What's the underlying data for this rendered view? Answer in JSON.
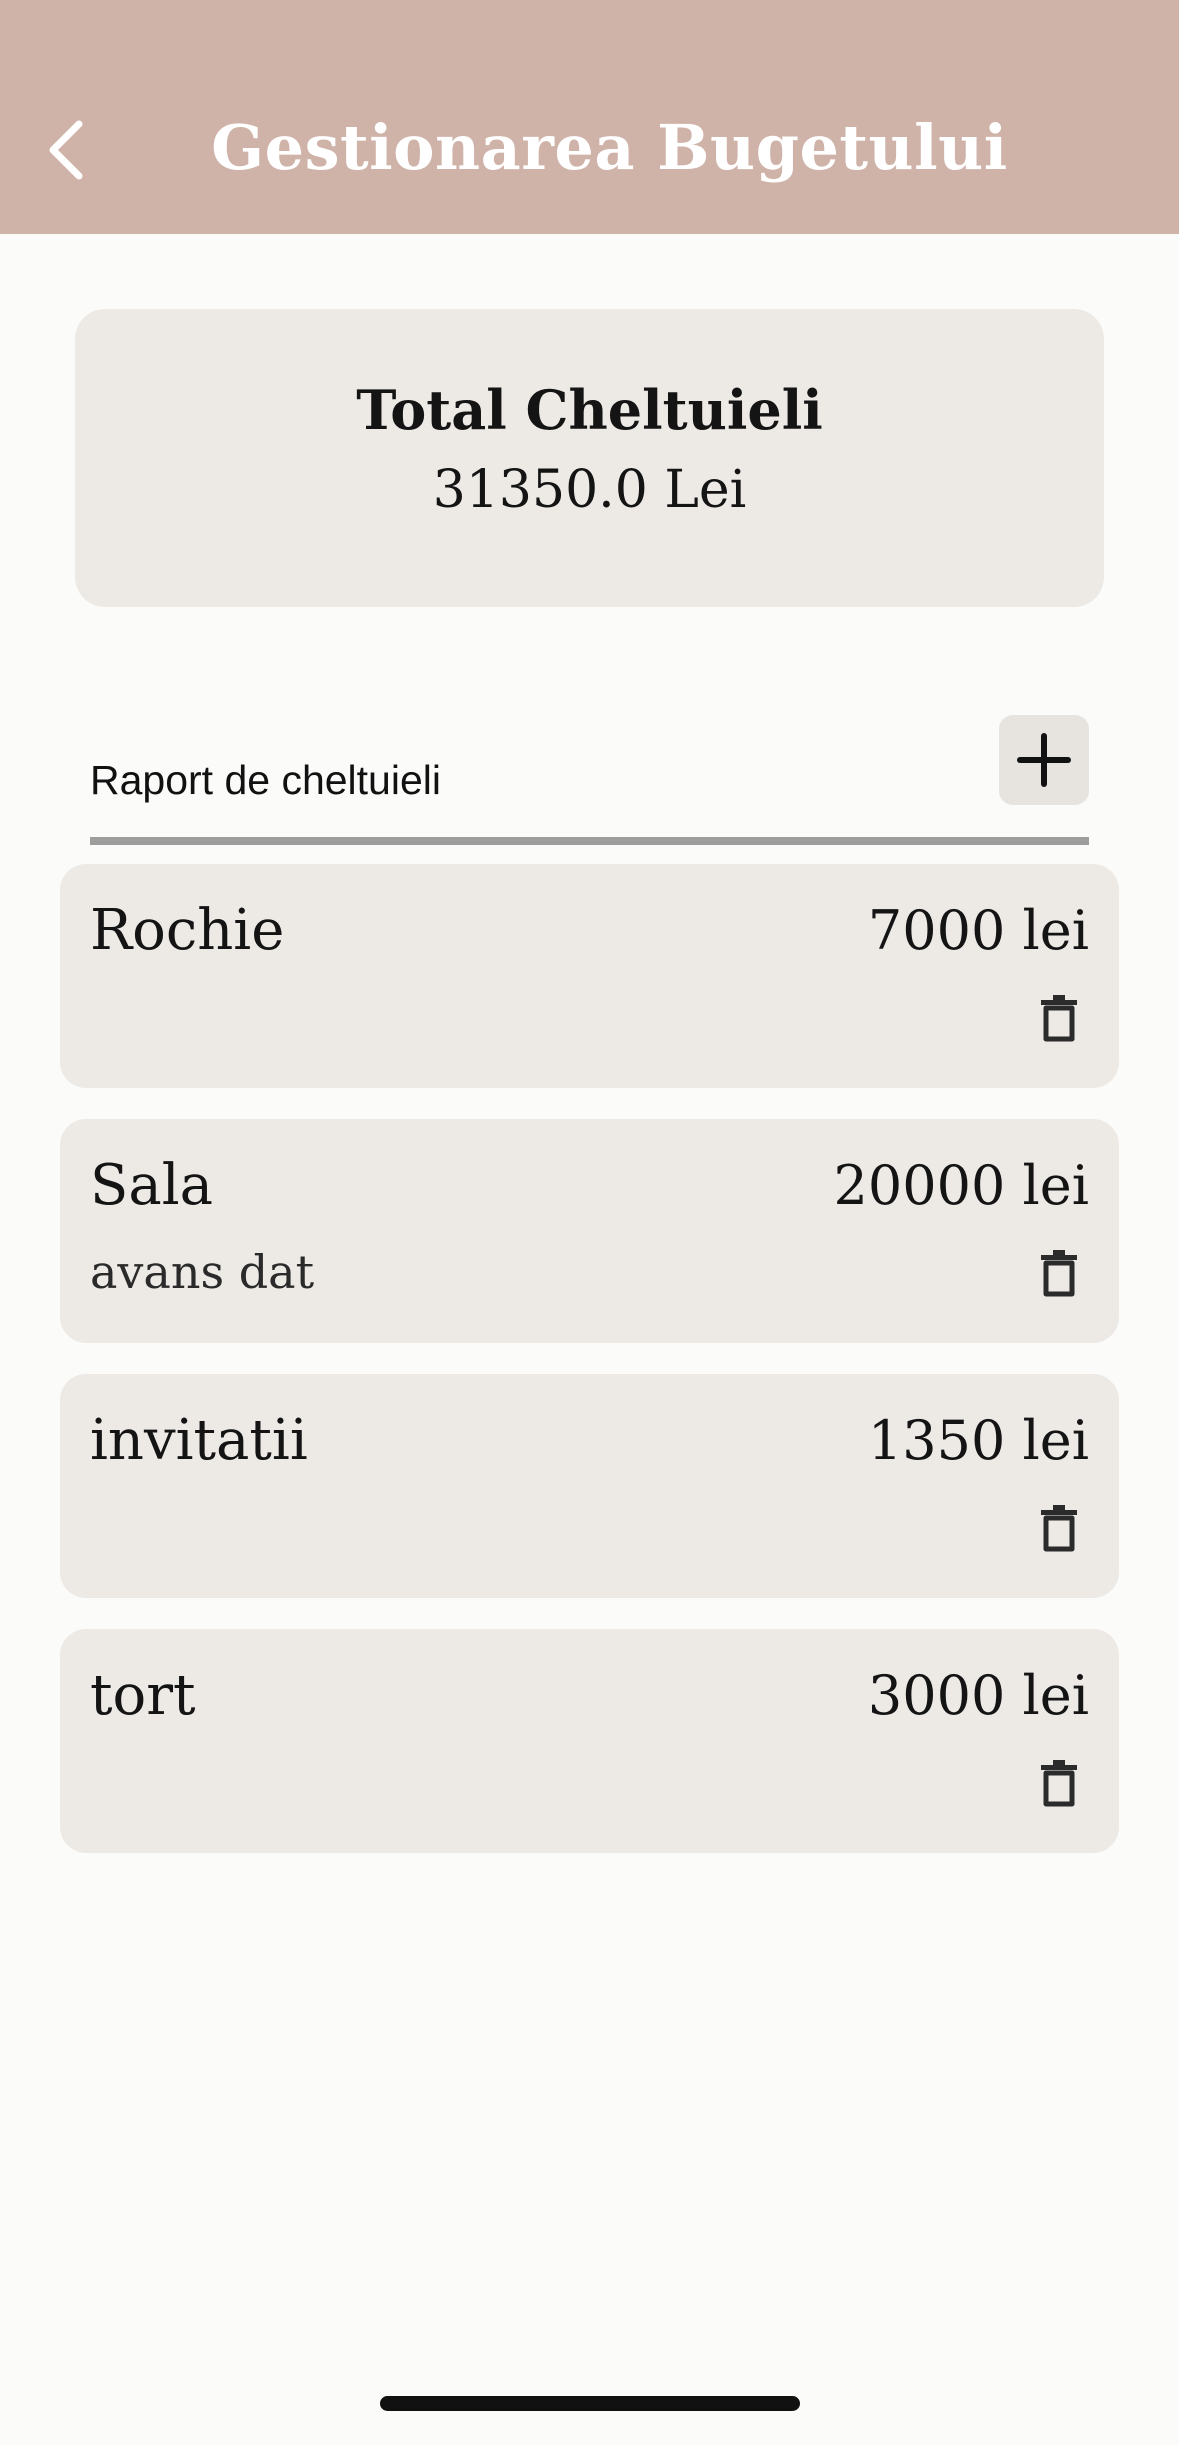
{
  "appbar": {
    "title": "Gestionarea Bugetului",
    "back_icon": "chevron-left-icon",
    "background": "#cfb2a8"
  },
  "summary": {
    "label": "Total Cheltuieli",
    "value": "31350.0 Lei"
  },
  "report": {
    "title": "Raport de cheltuieli",
    "add_icon": "plus-icon"
  },
  "expenses": [
    {
      "name": "Rochie",
      "amount": "7000 lei",
      "note": "",
      "delete_icon": "trash-icon"
    },
    {
      "name": "Sala",
      "amount": "20000 lei",
      "note": "avans dat",
      "delete_icon": "trash-icon"
    },
    {
      "name": "invitatii",
      "amount": "1350 lei",
      "note": "",
      "delete_icon": "trash-icon"
    },
    {
      "name": "tort",
      "amount": "3000 lei",
      "note": "",
      "delete_icon": "trash-icon"
    }
  ]
}
